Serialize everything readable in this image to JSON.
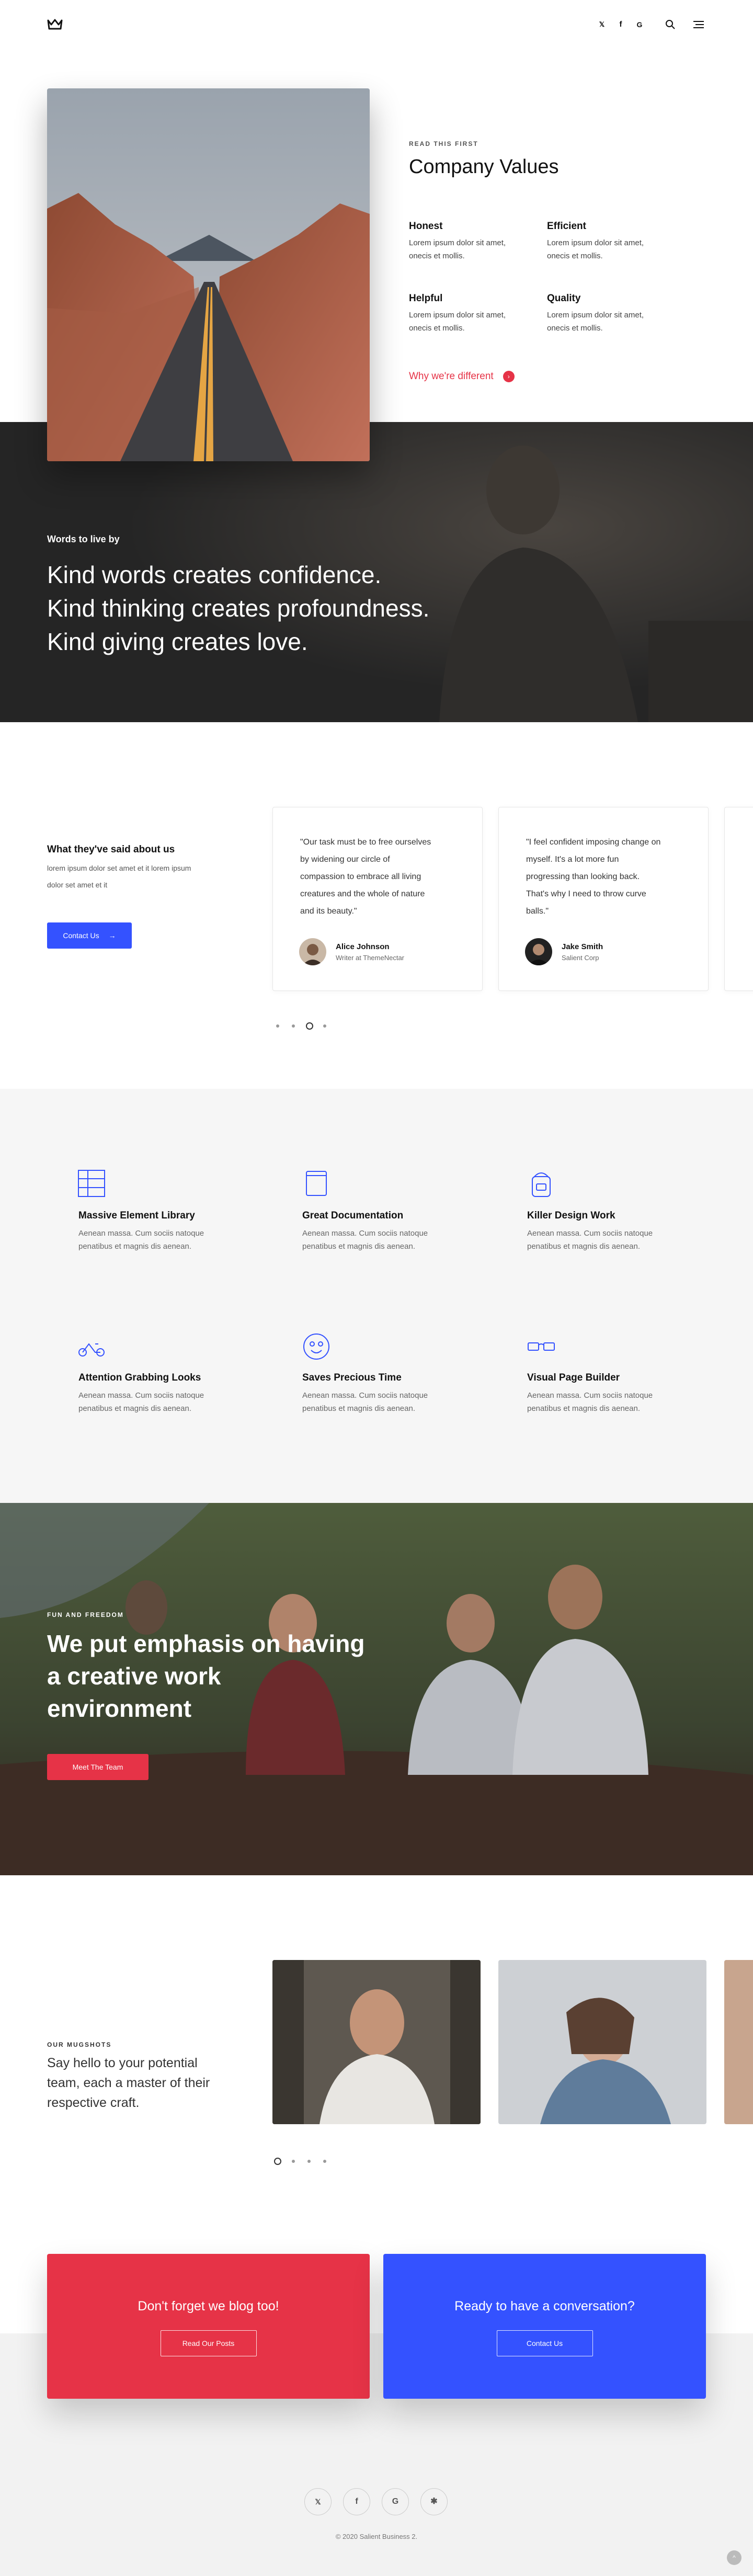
{
  "header": {
    "social": [
      "twitter-icon",
      "facebook-icon",
      "google-icon"
    ],
    "search_icon": "search-icon",
    "menu_icon": "menu-icon",
    "twitter_glyph": "𝕏",
    "facebook_glyph": "f",
    "google_glyph": "G"
  },
  "about": {
    "eyebrow": "READ THIS FIRST",
    "title": "Company Values",
    "values": [
      {
        "title": "Honest",
        "text1": "Lorem ipsum dolor sit amet,",
        "text2": "onecis et mollis."
      },
      {
        "title": "Efficient",
        "text1": "Lorem ipsum dolor sit amet,",
        "text2": "onecis et mollis."
      },
      {
        "title": "Helpful",
        "text1": "Lorem ipsum dolor sit amet,",
        "text2": "onecis et mollis."
      },
      {
        "title": "Quality",
        "text1": "Lorem ipsum dolor sit amet,",
        "text2": "onecis et mollis."
      }
    ],
    "link": "Why we're different",
    "link_arrow": "›"
  },
  "quote_band": {
    "overline": "Words to live by",
    "lines": [
      "Kind words creates confidence.",
      "Kind thinking creates profoundness.",
      "Kind giving creates love."
    ]
  },
  "testimonials": {
    "heading": "What they've said about us",
    "text1": "lorem ipsum dolor set amet et it lorem ipsum",
    "text2": "dolor set amet et it",
    "button": "Contact Us",
    "button_arrow": "→",
    "cards": [
      {
        "quote": [
          "\"Our task must be to free ourselves",
          "by widening our circle of",
          "compassion to embrace all living",
          "creatures and the whole of nature",
          "and its beauty.\""
        ],
        "name": "Alice Johnson",
        "role": "Writer at ThemeNectar"
      },
      {
        "quote": [
          "\"I feel confident imposing change on",
          "myself. It's a lot more fun",
          "progressing than looking back.",
          "That's why I need to throw curve",
          "balls.\""
        ],
        "name": "Jake Smith",
        "role": "Salient Corp"
      }
    ],
    "slide_count": 4,
    "active_slide": 3
  },
  "features": [
    {
      "icon": "table-icon",
      "title": "Massive Element Library",
      "text1": "Aenean massa. Cum sociis natoque",
      "text2": "penatibus et magnis dis aenean."
    },
    {
      "icon": "book-icon",
      "title": "Great Documentation",
      "text1": "Aenean massa. Cum sociis natoque",
      "text2": "penatibus et magnis dis aenean."
    },
    {
      "icon": "bag-icon",
      "title": "Killer Design Work",
      "text1": "Aenean massa. Cum sociis natoque",
      "text2": "penatibus et magnis dis aenean."
    },
    {
      "icon": "scooter-icon",
      "title": "Attention Grabbing Looks",
      "text1": "Aenean massa. Cum sociis natoque",
      "text2": "penatibus et magnis dis aenean."
    },
    {
      "icon": "smiley-icon",
      "title": "Saves Precious Time",
      "text1": "Aenean massa. Cum sociis natoque",
      "text2": "penatibus et magnis dis aenean."
    },
    {
      "icon": "glasses-icon",
      "title": "Visual Page Builder",
      "text1": "Aenean massa. Cum sociis natoque",
      "text2": "penatibus et magnis dis aenean."
    }
  ],
  "environment": {
    "eyebrow": "FUN AND FREEDOM",
    "lines": [
      "We put emphasis on having",
      "a creative work",
      "environment"
    ],
    "button": "Meet The Team"
  },
  "team": {
    "eyebrow": "OUR MUGSHOTS",
    "lines": [
      "Say hello to your potential",
      "team, each a master of their",
      "respective craft."
    ],
    "slide_count": 4,
    "active_slide": 1
  },
  "cta": {
    "blog_title": "Don't forget we blog too!",
    "blog_button": "Read Our Posts",
    "contact_title": "Ready to have a conversation?",
    "contact_button": "Contact Us"
  },
  "footer": {
    "social_glyphs": [
      "𝕏",
      "f",
      "G",
      "✱"
    ],
    "copyright": "© 2020 Salient Business 2.",
    "to_top_glyph": "^"
  },
  "colors": {
    "accent_red": "#e63347",
    "accent_blue": "#3452ff",
    "dark_band": "#2a2a2a"
  }
}
